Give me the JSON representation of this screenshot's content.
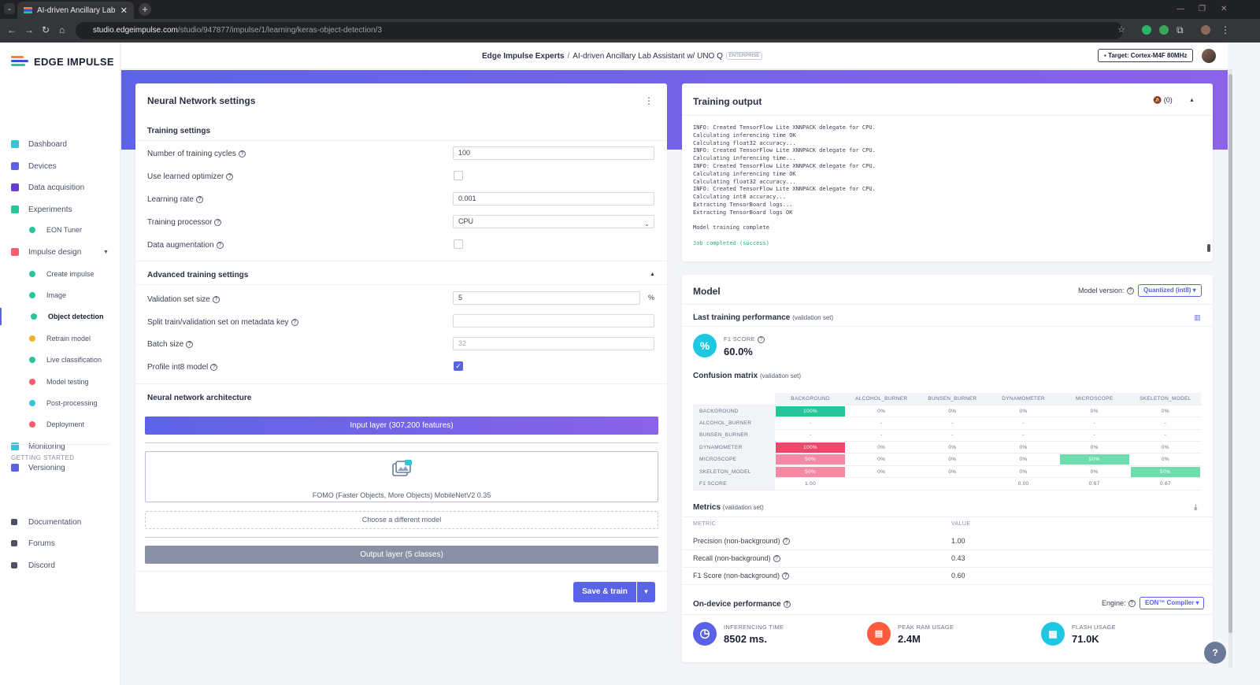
{
  "browser": {
    "tab_title": "AI-driven Ancillary Lab Assistant",
    "url_host": "studio.edgeimpulse.com",
    "url_path": "/studio/947877/impulse/1/learning/keras-object-detection/3"
  },
  "brand": {
    "name": "EDGE IMPULSE",
    "logo_colors": [
      "#ff7b3a",
      "#3b4bdb",
      "#27c59a"
    ]
  },
  "sidebar": {
    "items": [
      {
        "label": "Dashboard",
        "icon": "monitor-icon",
        "color": "#32c6d6"
      },
      {
        "label": "Devices",
        "icon": "devices-icon",
        "color": "#5a62e6"
      },
      {
        "label": "Data acquisition",
        "icon": "database-icon",
        "color": "#6a3ad6"
      },
      {
        "label": "Experiments",
        "icon": "grid-icon",
        "color": "#27c59a"
      },
      {
        "label": "EON Tuner",
        "icon": "tuner-icon",
        "color": "#27c59a"
      },
      {
        "label": "Impulse design",
        "icon": "pulse-icon",
        "color": "#ff5a6e"
      },
      {
        "label": "Create impulse",
        "icon": "dot-icon",
        "color": "#27c59a"
      },
      {
        "label": "Image",
        "icon": "dot-icon",
        "color": "#27c59a"
      },
      {
        "label": "Object detection",
        "icon": "dot-icon",
        "color": "#27c59a"
      },
      {
        "label": "Retrain model",
        "icon": "shuffle-icon",
        "color": "#f0b429"
      },
      {
        "label": "Live classification",
        "icon": "tree-icon",
        "color": "#27c59a"
      },
      {
        "label": "Model testing",
        "icon": "clipboard-icon",
        "color": "#ff5a6e"
      },
      {
        "label": "Post-processing",
        "icon": "page-icon",
        "color": "#32c6d6"
      },
      {
        "label": "Deployment",
        "icon": "gift-icon",
        "color": "#ff5a6e"
      },
      {
        "label": "Monitoring",
        "icon": "people-icon",
        "color": "#32c6d6"
      },
      {
        "label": "Versioning",
        "icon": "branch-icon",
        "color": "#5a62e6"
      }
    ],
    "getting_started": "GETTING STARTED",
    "links": [
      {
        "label": "Documentation",
        "icon": "book-icon"
      },
      {
        "label": "Forums",
        "icon": "chat-icon"
      },
      {
        "label": "Discord",
        "icon": "discord-icon"
      }
    ]
  },
  "header": {
    "project_owner": "Edge Impulse Experts",
    "separator": "/",
    "project_name": "AI-driven Ancillary Lab Assistant w/ UNO Q",
    "badge": "ENTERPRISE",
    "target": "Target: Cortex-M4F 80MHz"
  },
  "nn": {
    "title": "Neural Network settings",
    "training_settings": "Training settings",
    "training_cycles_label": "Number of training cycles",
    "training_cycles": "100",
    "learned_optimizer_label": "Use learned optimizer",
    "learning_rate_label": "Learning rate",
    "learning_rate": "0.001",
    "processor_label": "Training processor",
    "processor": "CPU",
    "augmentation_label": "Data augmentation",
    "advanced_title": "Advanced training settings",
    "validation_label": "Validation set size",
    "validation": "5",
    "validation_unit": "%",
    "split_label": "Split train/validation set on metadata key",
    "split_value": "",
    "batch_label": "Batch size",
    "batch_placeholder": "32",
    "profile_label": "Profile int8 model",
    "arch_title": "Neural network architecture",
    "input_layer": "Input layer (307,200 features)",
    "model_name": "FOMO (Faster Objects, More Objects) MobileNetV2 0.35",
    "choose_model": "Choose a different model",
    "output_layer": "Output layer (5 classes)",
    "save_train": "Save & train"
  },
  "training_output": {
    "title": "Training output",
    "notif_count": "(0)",
    "log_lines": [
      "INFO: Created TensorFlow Lite XNNPACK delegate for CPU.",
      "Calculating inferencing time OK",
      "Calculating float32 accuracy...",
      "INFO: Created TensorFlow Lite XNNPACK delegate for CPU.",
      "Calculating inferencing time...",
      "INFO: Created TensorFlow Lite XNNPACK delegate for CPU.",
      "Calculating inferencing time OK",
      "Calculating float32 accuracy...",
      "INFO: Created TensorFlow Lite XNNPACK delegate for CPU.",
      "Calculating int8 accuracy...",
      "Extracting TensorBoard logs...",
      "Extracting TensorBoard logs OK",
      "",
      "Model training complete",
      ""
    ],
    "success_line": "Job completed (success)"
  },
  "model": {
    "title": "Model",
    "version_label": "Model version:",
    "version": "Quantized (int8)",
    "last_perf": "Last training performance",
    "validation_set": "(validation set)",
    "f1_label": "F1 SCORE",
    "f1_value": "60.0%",
    "cm_title": "Confusion matrix",
    "cm_columns": [
      "BACKGROUND",
      "ALCOHOL_BURNER",
      "BUNSEN_BURNER",
      "DYNAMOMETER",
      "MICROSCOPE",
      "SKELETON_MODEL"
    ],
    "cm_rows": [
      {
        "label": "BACKGROUND",
        "cells": [
          "100%",
          "0%",
          "0%",
          "0%",
          "0%",
          "0%"
        ]
      },
      {
        "label": "ALCOHOL_BURNER",
        "cells": [
          "-",
          "-",
          "-",
          "-",
          "-",
          "-"
        ]
      },
      {
        "label": "BUNSEN_BURNER",
        "cells": [
          "-",
          "-",
          "-",
          "-",
          "-",
          "-"
        ]
      },
      {
        "label": "DYNAMOMETER",
        "cells": [
          "100%",
          "0%",
          "0%",
          "0%",
          "0%",
          "0%"
        ]
      },
      {
        "label": "MICROSCOPE",
        "cells": [
          "50%",
          "0%",
          "0%",
          "0%",
          "50%",
          "0%"
        ]
      },
      {
        "label": "SKELETON_MODEL",
        "cells": [
          "50%",
          "0%",
          "0%",
          "0%",
          "0%",
          "50%"
        ]
      },
      {
        "label": "F1 SCORE",
        "cells": [
          "1.00",
          "",
          "",
          "0.00",
          "0.67",
          "0.67"
        ]
      }
    ],
    "metrics_title": "Metrics",
    "metric_col": "METRIC",
    "value_col": "VALUE",
    "metrics": [
      {
        "name": "Precision (non-background)",
        "value": "1.00"
      },
      {
        "name": "Recall (non-background)",
        "value": "0.43"
      },
      {
        "name": "F1 Score (non-background)",
        "value": "0.60"
      }
    ],
    "ondevice_title": "On-device performance",
    "engine_label": "Engine:",
    "engine": "EON™ Compiler",
    "inferencing_label": "INFERENCING TIME",
    "inferencing_value": "8502 ms.",
    "ram_label": "PEAK RAM USAGE",
    "ram_value": "2.4M",
    "flash_label": "FLASH USAGE",
    "flash_value": "71.0K"
  },
  "colors": {
    "accent": "#5a62e6",
    "green": "#27c59a",
    "red": "#f0466a",
    "pink": "#f58aa5"
  }
}
